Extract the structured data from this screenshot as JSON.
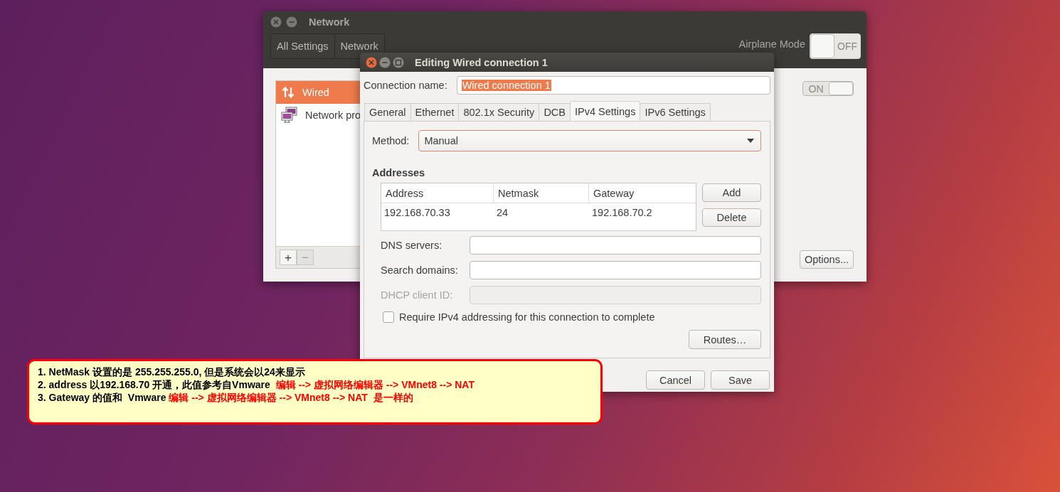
{
  "network_window": {
    "title": "Network",
    "nav": [
      "All Settings",
      "Network"
    ],
    "airplane_mode": {
      "label": "Airplane Mode",
      "on": false,
      "state_text": "OFF"
    },
    "connections": [
      {
        "kind": "wired",
        "name": "Wired",
        "selected": true
      },
      {
        "kind": "proxy",
        "name": "Network pro",
        "selected": false
      }
    ],
    "list_buttons": [
      {
        "label": "+",
        "disabled": false
      },
      {
        "label": "−",
        "disabled": true
      }
    ],
    "wired_switch": {
      "on": true,
      "state_text": "ON"
    },
    "options_button": "Options..."
  },
  "dialog": {
    "title": "Editing Wired connection 1",
    "connection_name": {
      "label": "Connection name:",
      "value": "Wired connection 1",
      "text_selected": true
    },
    "tabs": [
      {
        "label": "General",
        "selected": false
      },
      {
        "label": "Ethernet",
        "selected": false
      },
      {
        "label": "802.1x Security",
        "selected": false
      },
      {
        "label": "DCB",
        "selected": false
      },
      {
        "label": "IPv4 Settings",
        "selected": true
      },
      {
        "label": "IPv6 Settings",
        "selected": false
      }
    ],
    "method": {
      "label": "Method:",
      "value": "Manual"
    },
    "addresses": {
      "title": "Addresses",
      "columns": [
        "Address",
        "Netmask",
        "Gateway"
      ],
      "rows": [
        [
          "192.168.70.33",
          "24",
          "192.168.70.2"
        ]
      ],
      "buttons": [
        "Add",
        "Delete"
      ]
    },
    "fields": [
      {
        "label": "DNS servers:",
        "disabled": false
      },
      {
        "label": "Search domains:",
        "disabled": false
      },
      {
        "label": "DHCP client ID:",
        "disabled": true
      }
    ],
    "require_ipv4": {
      "label": "Require IPv4 addressing for this connection to complete",
      "checked": false
    },
    "routes_button": "Routes…",
    "buttons": [
      "Cancel",
      "Save"
    ]
  },
  "annotation": {
    "lines": [
      [
        {
          "text": "1. NetMask 设置的是 255.255.255.0, 但是系统会以24来显示",
          "emphasis": false
        }
      ],
      [
        {
          "text": "2. address 以192.168.70 开通，此值参考自Vmware  ",
          "emphasis": false
        },
        {
          "text": "编辑 --> 虚拟网络编辑器 --> VMnet8 --> NAT",
          "emphasis": true
        }
      ],
      [
        {
          "text": "3. Gateway 的值和  Vmware ",
          "emphasis": false
        },
        {
          "text": "编辑 --> 虚拟网络编辑器 --> VMnet8 --> NAT  是一样的",
          "emphasis": true
        }
      ]
    ]
  }
}
